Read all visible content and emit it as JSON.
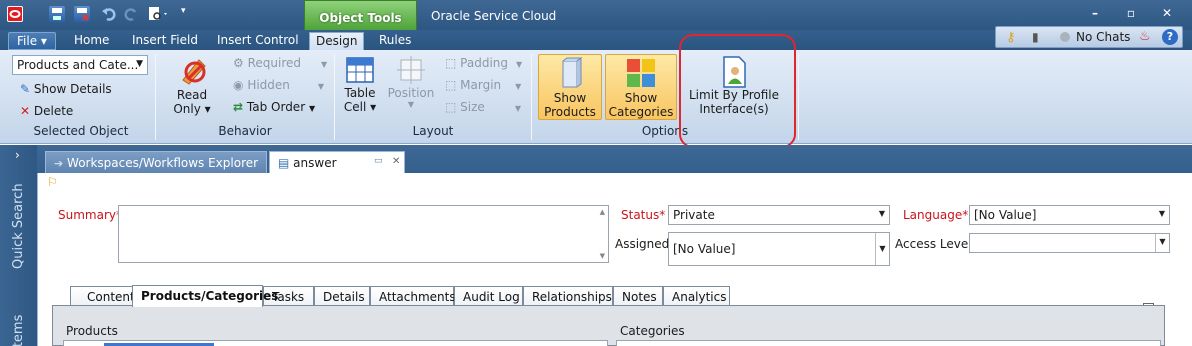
{
  "app": {
    "title": "Oracle Service Cloud",
    "contextual_group": "Object Tools"
  },
  "ribbon_tabs": [
    "File",
    "Home",
    "Insert Field",
    "Insert Control",
    "Design",
    "Rules"
  ],
  "active_tab": "Design",
  "right_panel": {
    "chats_label": "No Chats"
  },
  "selected_object": {
    "combo_value": "Products and Cate...",
    "show_details": "Show Details",
    "delete": "Delete",
    "group_label": "Selected Object"
  },
  "behavior": {
    "read_only_line1": "Read",
    "read_only_line2": "Only",
    "required": "Required",
    "hidden": "Hidden",
    "tab_order": "Tab Order",
    "group_label": "Behavior"
  },
  "layout": {
    "table_cell_line1": "Table",
    "table_cell_line2": "Cell",
    "position": "Position",
    "padding": "Padding",
    "margin": "Margin",
    "size": "Size",
    "group_label": "Layout"
  },
  "options": {
    "show_products_line1": "Show",
    "show_products_line2": "Products",
    "show_categories_line1": "Show",
    "show_categories_line2": "Categories",
    "limit_line1": "Limit By Profile",
    "limit_line2": "Interface(s)",
    "group_label": "Options"
  },
  "left_nav": {
    "quick_search": "Quick Search",
    "items": "Items"
  },
  "doc_tabs": [
    "Workspaces/Workflows Explorer",
    "answer"
  ],
  "form": {
    "summary_label": "Summary",
    "status_label": "Status",
    "status_value": "Private",
    "language_label": "Language",
    "language_value": "[No Value]",
    "assigned_label": "Assigned",
    "assigned_value": "[No Value]",
    "access_level_label": "Access Level",
    "access_level_value": "",
    "required_mark": "*"
  },
  "detail_tabs": [
    "Content",
    "Products/Categories",
    "Tasks",
    "Details",
    "Attachments",
    "Audit Log",
    "Relationships",
    "Notes",
    "Analytics"
  ],
  "detail_active": "Products/Categories",
  "panel": {
    "products_header": "Products",
    "categories_header": "Categories"
  },
  "colors": {
    "ribbon_bg": "#cddced",
    "titlebar": "#2d5783",
    "accent_green": "#4ea33a",
    "highlight": "#f9c560",
    "annotation_red": "#e0262e",
    "required_red": "#c8141c"
  }
}
